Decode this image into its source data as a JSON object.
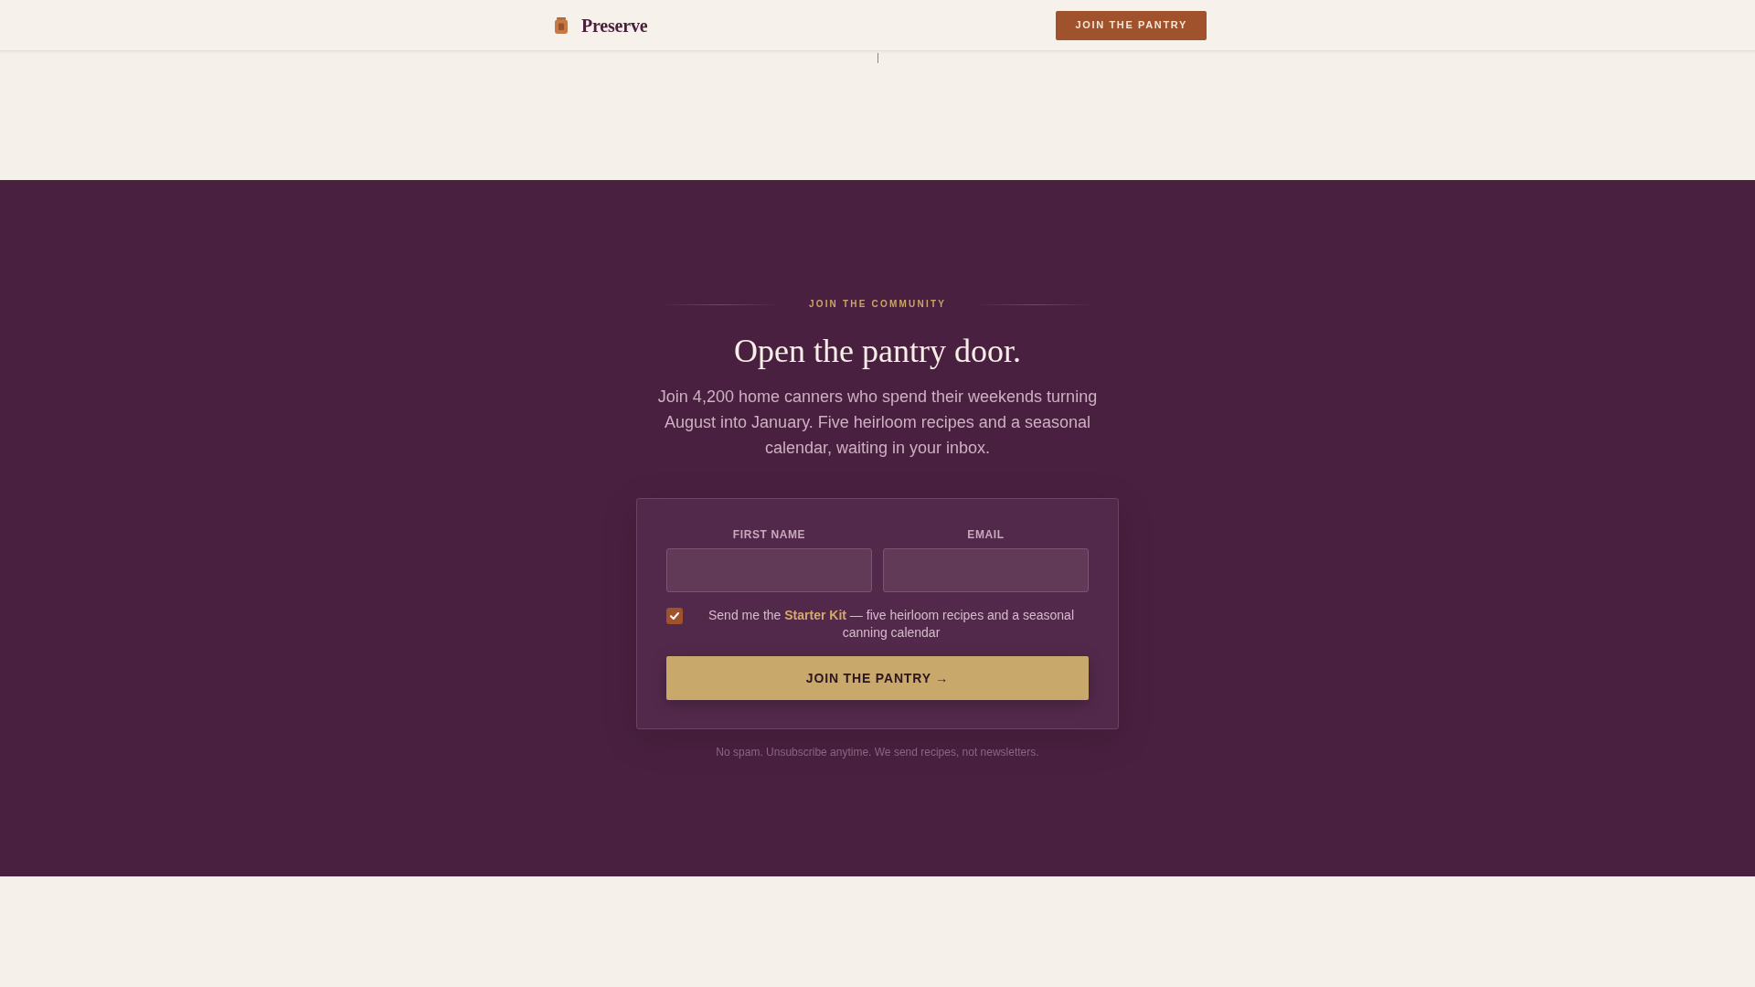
{
  "header": {
    "brand": "Preserve",
    "cta": "JOIN THE PANTRY"
  },
  "signup": {
    "eyebrow": "JOIN THE COMMUNITY",
    "title": "Open the pantry door.",
    "intro": "Join 4,200 home canners who spend their weekends turning August into January. Five heirloom recipes and a seasonal calendar, waiting in your inbox.",
    "form": {
      "fields": [
        {
          "label": "FIRST NAME"
        },
        {
          "label": "EMAIL"
        }
      ],
      "consent": {
        "checked": true,
        "text": "Send me the **Starter Kit** — five heirloom recipes and a seasonal canning calendar"
      },
      "submit": "JOIN THE PANTRY →"
    },
    "note": "No spam. Unsubscribe anytime. We send recipes, not newsletters."
  }
}
